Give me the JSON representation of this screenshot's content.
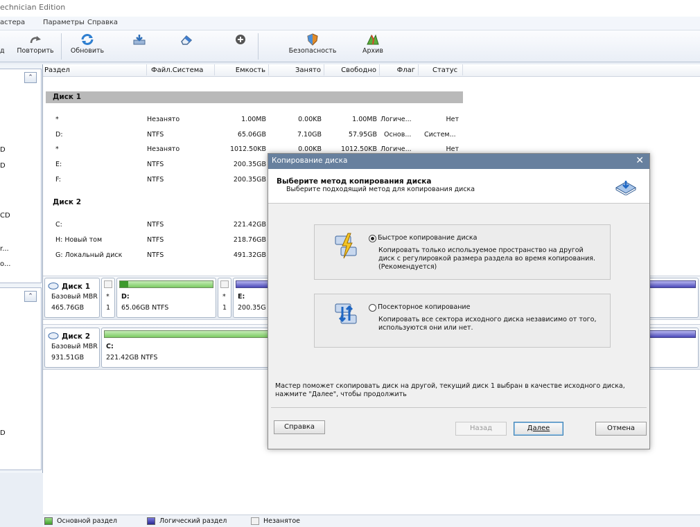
{
  "window": {
    "title": "echnician Edition"
  },
  "menu": {
    "items": [
      "астера",
      "Параметры",
      "Справка"
    ]
  },
  "toolbar": {
    "cut_label": "д",
    "redo_label": "Повторить",
    "refresh_label": "Обновить",
    "security_label": "Безопасность",
    "archive_label": "Архив"
  },
  "leftpanel": {
    "fragments": [
      "D",
      "D",
      "CD",
      "r...",
      "o...",
      "D"
    ]
  },
  "grid": {
    "headers": [
      "Раздел",
      "Файл.Система",
      "Емкость",
      "Занято",
      "Свободно",
      "Флаг",
      "Статус"
    ],
    "disk1_label": "Диск 1",
    "disk2_label": "Диск 2",
    "disk1_rows": [
      {
        "name": "*",
        "fs": "Незанято",
        "cap": "1.00MB",
        "used": "0.00KB",
        "free": "1.00MB",
        "flag": "Логиче...",
        "status": "Нет"
      },
      {
        "name": "D:",
        "fs": "NTFS",
        "cap": "65.06GB",
        "used": "7.10GB",
        "free": "57.95GB",
        "flag": "Основ...",
        "status": "Систем..."
      },
      {
        "name": "*",
        "fs": "Незанято",
        "cap": "1012.50KB",
        "used": "0.00KB",
        "free": "1012.50KB",
        "flag": "Логиче...",
        "status": "Нет"
      },
      {
        "name": "E:",
        "fs": "NTFS",
        "cap": "200.35GB",
        "used": "",
        "free": "",
        "flag": "",
        "status": ""
      },
      {
        "name": "F:",
        "fs": "NTFS",
        "cap": "200.35GB",
        "used": "",
        "free": "",
        "flag": "",
        "status": ""
      }
    ],
    "disk2_rows": [
      {
        "name": "C:",
        "fs": "NTFS",
        "cap": "221.42GB"
      },
      {
        "name": "H: Новый том",
        "fs": "NTFS",
        "cap": "218.76GB"
      },
      {
        "name": "G: Локальный диск",
        "fs": "NTFS",
        "cap": "491.32GB"
      }
    ]
  },
  "diskmap": {
    "disk1": {
      "name": "Диск 1",
      "type": "Базовый MBR",
      "size": "465.76GB",
      "p_star1": "*",
      "p_star1_num": "1",
      "p_d_label": "D:",
      "p_d_info": "65.06GB NTFS",
      "p_star2": "*",
      "p_star2_num": "1",
      "p_e_label": "E:",
      "p_e_info": "200.35G"
    },
    "disk2": {
      "name": "Диск 2",
      "type": "Базовый MBR",
      "size": "931.51GB",
      "p_c_label": "C:",
      "p_c_info": "221.42GB NTFS"
    }
  },
  "status": {
    "primary": "Основной раздел",
    "logical": "Логический раздел",
    "unallocated": "Незанятое",
    "colors": {
      "primary": "#5fbf4a",
      "logical": "#3d3bb0",
      "unallocated": "#f2f2f2"
    }
  },
  "dialog": {
    "title": "Копирование диска",
    "close": "✕",
    "heading": "Выберите метод копирования диска",
    "subheading": "Выберите подходящий метод для копирования диска",
    "option1_title": "Быстрое копирование диска",
    "option1_desc": "Копировать только используемое пространство на другой диск с регулировкой размера раздела во время копирования.(Рекомендуется)",
    "option2_title": "Посекторное копирование",
    "option2_desc": "Копировать все сектора исходного диска независимо от того, используются они или нет.",
    "info": "Мастер поможет скопировать диск на другой, текущий диск 1 выбран в качестве исходного диска, нажмите \"Далее\", чтобы продолжить",
    "help_btn": "Справка",
    "back_btn": "Назад",
    "next_btn": "Далее",
    "cancel_btn": "Отмена"
  }
}
